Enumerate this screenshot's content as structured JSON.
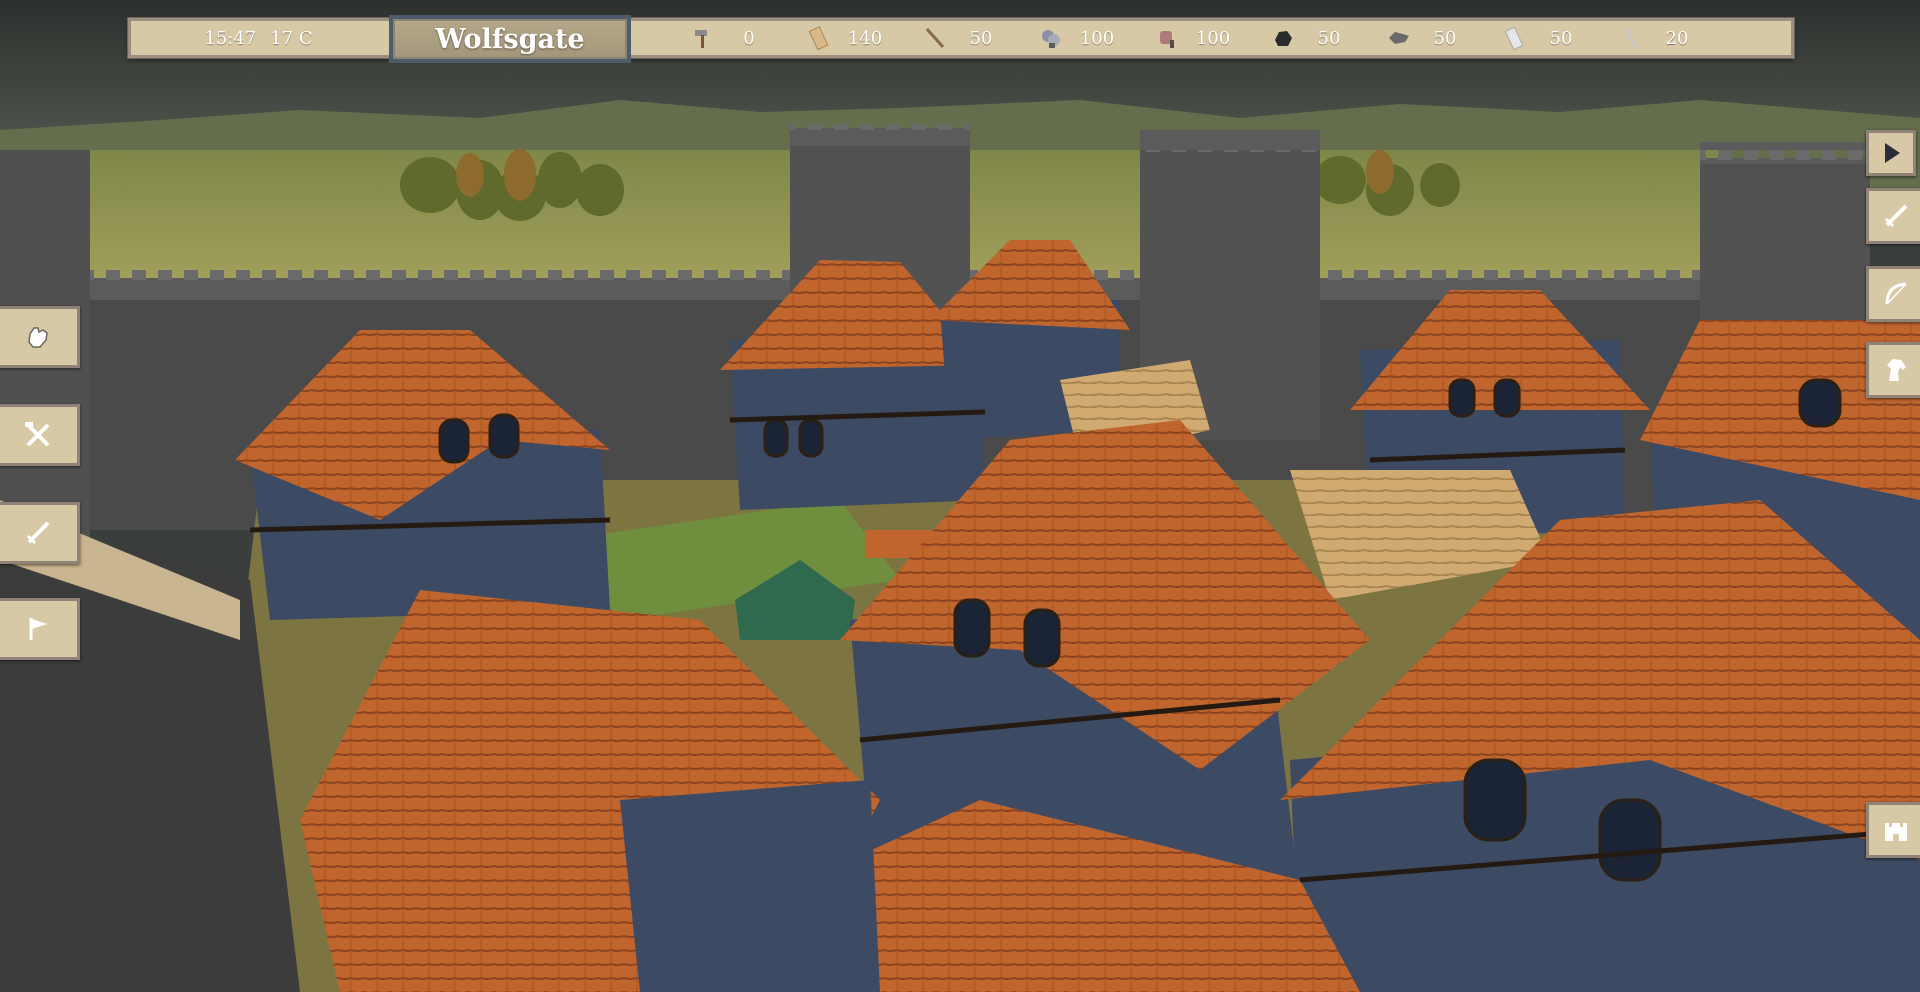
{
  "hud": {
    "time": "15:47",
    "temperature": "17 C",
    "town_name": "Wolfsgate",
    "resources": [
      {
        "icon": "hammer-icon",
        "value": "0"
      },
      {
        "icon": "plank-icon",
        "value": "140"
      },
      {
        "icon": "stick-icon",
        "value": "50"
      },
      {
        "icon": "iron-ore-icon",
        "value": "100"
      },
      {
        "icon": "meat-icon",
        "value": "100"
      },
      {
        "icon": "coal-icon",
        "value": "50"
      },
      {
        "icon": "hide-icon",
        "value": "50"
      },
      {
        "icon": "iron-bar-icon",
        "value": "50"
      },
      {
        "icon": "sword-blade-icon",
        "value": "20"
      }
    ]
  },
  "left_menu": [
    {
      "icon": "fist-icon"
    },
    {
      "icon": "crossed-tools-icon"
    },
    {
      "icon": "sword-icon"
    },
    {
      "icon": "flag-icon"
    }
  ],
  "right_menu": [
    {
      "icon": "play-icon"
    },
    {
      "icon": "sword-icon"
    },
    {
      "icon": "bow-icon"
    },
    {
      "icon": "horse-icon"
    },
    {
      "icon": "castle-icon"
    }
  ],
  "colors": {
    "hud_bg": "#d8c9a6",
    "hud_border": "#9c8f80",
    "title_border": "#4d5b6b",
    "roof": "#c0652e",
    "wall_stone": "#4a4a4a",
    "grass": "#9b9d55"
  }
}
